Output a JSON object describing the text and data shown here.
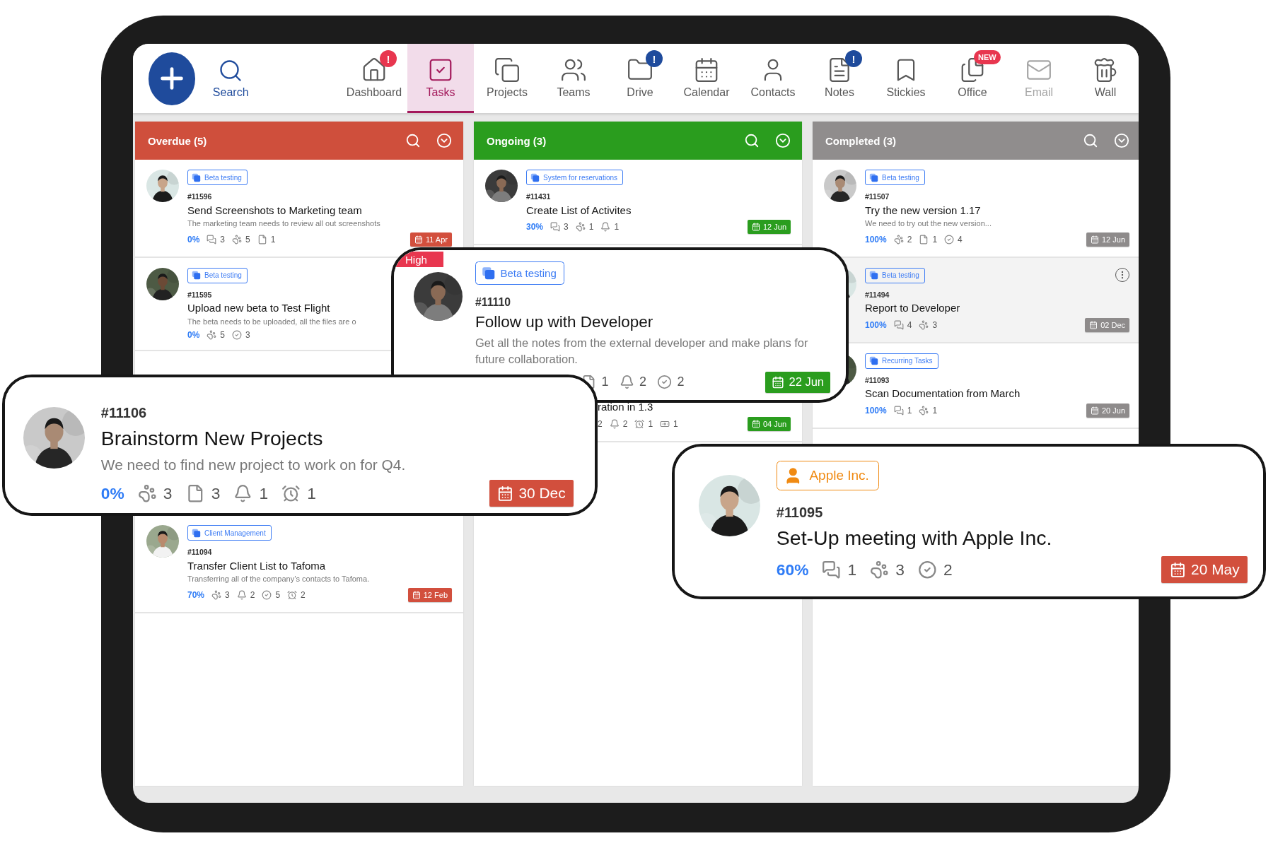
{
  "nav": {
    "search": "Search",
    "items": [
      {
        "label": "Dashboard",
        "selected": false,
        "disabled": false,
        "badge": {
          "text": "!",
          "color": "#e8364f"
        }
      },
      {
        "label": "Tasks",
        "selected": true,
        "disabled": false
      },
      {
        "label": "Projects",
        "selected": false,
        "disabled": false
      },
      {
        "label": "Teams",
        "selected": false,
        "disabled": false
      },
      {
        "label": "Drive",
        "selected": false,
        "disabled": false,
        "badge": {
          "text": "!",
          "color": "#1f4b9c"
        }
      },
      {
        "label": "Calendar",
        "selected": false,
        "disabled": false
      },
      {
        "label": "Contacts",
        "selected": false,
        "disabled": false
      },
      {
        "label": "Notes",
        "selected": false,
        "disabled": false,
        "badge": {
          "text": "!",
          "color": "#1f4b9c"
        }
      },
      {
        "label": "Stickies",
        "selected": false,
        "disabled": false
      },
      {
        "label": "Office",
        "selected": false,
        "disabled": false,
        "badge": {
          "text": "NEW",
          "color": "#e8364f"
        }
      },
      {
        "label": "Email",
        "selected": false,
        "disabled": true
      },
      {
        "label": "Wall",
        "selected": false,
        "disabled": false
      }
    ]
  },
  "columns": [
    {
      "kind": "overdue",
      "title": "Overdue (5)",
      "cards": [
        {
          "kind": "full",
          "highlighted": false,
          "tag": {
            "kind": "project",
            "label": "Beta testing"
          },
          "id": "#11596",
          "title": "Send Screenshots to Marketing team",
          "description": "The marketing team needs to review all out screenshots",
          "progress": "0%",
          "stats": [
            {
              "kind": "comment",
              "value": "3"
            },
            {
              "kind": "paw",
              "value": "5"
            },
            {
              "kind": "file",
              "value": "1"
            }
          ],
          "date": "11 Apr"
        },
        {
          "kind": "full",
          "highlighted": false,
          "tag": {
            "kind": "project",
            "label": "Beta testing"
          },
          "id": "#11595",
          "title": "Upload new beta to Test Flight",
          "description": "The beta needs to be uploaded, all the files are o",
          "progress": "0%",
          "stats": [
            {
              "kind": "paw",
              "value": "5"
            },
            {
              "kind": "check",
              "value": "3"
            }
          ]
        },
        {
          "kind": "full",
          "highlighted": false,
          "tag": {
            "kind": "project",
            "label": "Client Management"
          },
          "id": "#11094",
          "title": "Transfer Client List to Tafoma",
          "description": "Transferring all of the company’s contacts to Tafoma.",
          "progress": "70%",
          "stats": [
            {
              "kind": "paw",
              "value": "3"
            },
            {
              "kind": "bell",
              "value": "2"
            },
            {
              "kind": "check",
              "value": "5"
            },
            {
              "kind": "alarm",
              "value": "2"
            }
          ],
          "date": "12 Feb"
        }
      ]
    },
    {
      "kind": "ongoing",
      "title": "Ongoing (3)",
      "cards": [
        {
          "kind": "full",
          "highlighted": false,
          "tag": {
            "kind": "project",
            "label": "System for reservations"
          },
          "id": "#11431",
          "title": "Create List of Activites",
          "progress": "30%",
          "stats": [
            {
              "kind": "comment",
              "value": "3"
            },
            {
              "kind": "paw",
              "value": "1"
            },
            {
              "kind": "bell",
              "value": "1"
            }
          ],
          "date": "12 Jun"
        },
        {
          "kind": "partial",
          "highlighted": false,
          "title": "ration in 1.3",
          "stats": [
            {
              "kind": "plain",
              "value": "2"
            },
            {
              "kind": "bell",
              "value": "2"
            },
            {
              "kind": "alarm",
              "value": "1"
            },
            {
              "kind": "money",
              "value": "1"
            }
          ],
          "date": "04 Jun"
        }
      ]
    },
    {
      "kind": "completed",
      "title": "Completed (3)",
      "cards": [
        {
          "kind": "full",
          "highlighted": false,
          "tag": {
            "kind": "project",
            "label": "Beta testing"
          },
          "id": "#11507",
          "title": "Try the new version 1.17",
          "description": "We need to try out the new version...",
          "progress": "100%",
          "stats": [
            {
              "kind": "paw",
              "value": "2"
            },
            {
              "kind": "file",
              "value": "1"
            },
            {
              "kind": "check",
              "value": "4"
            }
          ],
          "date": "12 Jun"
        },
        {
          "kind": "full",
          "highlighted": true,
          "tag": {
            "kind": "project",
            "label": "Beta testing"
          },
          "id": "#11494",
          "title": "Report to Developer",
          "progress": "100%",
          "stats": [
            {
              "kind": "comment",
              "value": "4"
            },
            {
              "kind": "paw",
              "value": "3"
            }
          ],
          "date": "02 Dec"
        },
        {
          "kind": "full",
          "highlighted": false,
          "tag": {
            "kind": "project",
            "label": "Recurring Tasks"
          },
          "id": "#11093",
          "title": "Scan Documentation from March",
          "progress": "100%",
          "stats": [
            {
              "kind": "comment",
              "value": "1"
            },
            {
              "kind": "paw",
              "value": "1"
            }
          ],
          "date": "20 Jun"
        }
      ]
    }
  ],
  "overlays": [
    {
      "kind": "ongoing",
      "priority": "High",
      "tag": {
        "kind": "project",
        "label": "Beta testing"
      },
      "id": "#11110",
      "title": "Follow up with Developer",
      "description": "Get all the notes from the external developer and make plans for future collaboration.",
      "stats": [
        {
          "kind": "file",
          "value": "1"
        },
        {
          "kind": "bell",
          "value": "2"
        },
        {
          "kind": "check",
          "value": "2"
        }
      ],
      "date": "22 Jun"
    },
    {
      "kind": "overdue",
      "id": "#11106",
      "title": "Brainstorm New Projects",
      "description": "We need to find new project to work on for Q4.",
      "progress": "0%",
      "stats": [
        {
          "kind": "paw",
          "value": "3"
        },
        {
          "kind": "file",
          "value": "3"
        },
        {
          "kind": "bell",
          "value": "1"
        },
        {
          "kind": "alarm",
          "value": "1"
        }
      ],
      "date": "30 Dec"
    },
    {
      "kind": "overdue",
      "tag": {
        "kind": "client",
        "label": "Apple Inc."
      },
      "id": "#11095",
      "title": "Set-Up meeting with Apple Inc.",
      "progress": "60%",
      "stats": [
        {
          "kind": "comment",
          "value": "1"
        },
        {
          "kind": "paw",
          "value": "3"
        },
        {
          "kind": "check",
          "value": "2"
        }
      ],
      "date": "20 May"
    }
  ]
}
